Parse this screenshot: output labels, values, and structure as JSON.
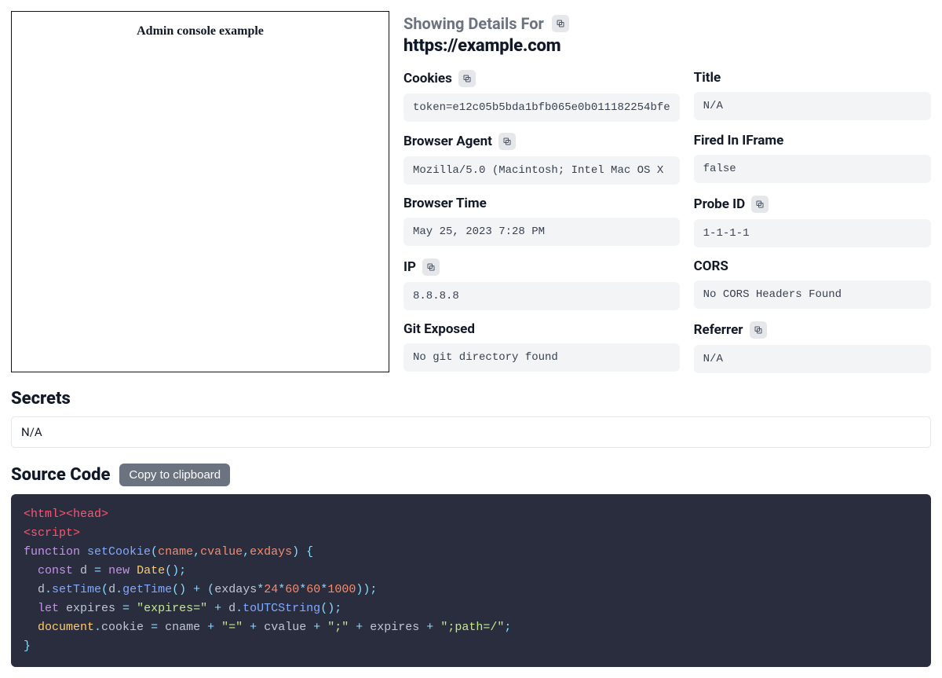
{
  "preview": {
    "title": "Admin console example"
  },
  "header": {
    "showing_label": "Showing Details For",
    "url": "https://example.com"
  },
  "fields": {
    "cookies": {
      "label": "Cookies",
      "value": "token=e12c05b5bda1bfb065e0b011182254bfe"
    },
    "title": {
      "label": "Title",
      "value": "N/A"
    },
    "browser_agent": {
      "label": "Browser Agent",
      "value": "Mozilla/5.0 (Macintosh; Intel Mac OS X"
    },
    "fired_iframe": {
      "label": "Fired In IFrame",
      "value": "false"
    },
    "browser_time": {
      "label": "Browser Time",
      "value": "May 25, 2023 7:28 PM"
    },
    "probe_id": {
      "label": "Probe ID",
      "value": "1-1-1-1"
    },
    "ip": {
      "label": "IP",
      "value": "8.8.8.8"
    },
    "cors": {
      "label": "CORS",
      "value": "No CORS Headers Found"
    },
    "git_exposed": {
      "label": "Git Exposed",
      "value": "No git directory found"
    },
    "referrer": {
      "label": "Referrer",
      "value": "N/A"
    }
  },
  "secrets": {
    "heading": "Secrets",
    "value": "N/A"
  },
  "source": {
    "heading": "Source Code",
    "copy_label": "Copy to clipboard"
  },
  "code_tokens": [
    [
      "tag",
      "<html>"
    ],
    [
      "tag",
      "<head>"
    ],
    [
      "nl",
      ""
    ],
    [
      "tag",
      "<script>"
    ],
    [
      "nl",
      ""
    ],
    [
      "kw",
      "function"
    ],
    [
      "default",
      " "
    ],
    [
      "fn",
      "setCookie"
    ],
    [
      "punct",
      "("
    ],
    [
      "param",
      "cname"
    ],
    [
      "punct",
      ","
    ],
    [
      "param",
      "cvalue"
    ],
    [
      "punct",
      ","
    ],
    [
      "param",
      "exdays"
    ],
    [
      "punct",
      ")"
    ],
    [
      "default",
      " "
    ],
    [
      "punct",
      "{"
    ],
    [
      "nl",
      ""
    ],
    [
      "default",
      "  "
    ],
    [
      "kw",
      "const"
    ],
    [
      "default",
      " d "
    ],
    [
      "punct",
      "="
    ],
    [
      "default",
      " "
    ],
    [
      "kw",
      "new"
    ],
    [
      "default",
      " "
    ],
    [
      "builtin",
      "Date"
    ],
    [
      "punct",
      "()"
    ],
    [
      "punct",
      ";"
    ],
    [
      "nl",
      ""
    ],
    [
      "default",
      "  d"
    ],
    [
      "punct",
      "."
    ],
    [
      "fn",
      "setTime"
    ],
    [
      "punct",
      "("
    ],
    [
      "default",
      "d"
    ],
    [
      "punct",
      "."
    ],
    [
      "fn",
      "getTime"
    ],
    [
      "punct",
      "()"
    ],
    [
      "default",
      " "
    ],
    [
      "punct",
      "+"
    ],
    [
      "default",
      " "
    ],
    [
      "punct",
      "("
    ],
    [
      "default",
      "exdays"
    ],
    [
      "punct",
      "*"
    ],
    [
      "num",
      "24"
    ],
    [
      "punct",
      "*"
    ],
    [
      "num",
      "60"
    ],
    [
      "punct",
      "*"
    ],
    [
      "num",
      "60"
    ],
    [
      "punct",
      "*"
    ],
    [
      "num",
      "1000"
    ],
    [
      "punct",
      "))"
    ],
    [
      "punct",
      ";"
    ],
    [
      "nl",
      ""
    ],
    [
      "default",
      "  "
    ],
    [
      "kw",
      "let"
    ],
    [
      "default",
      " expires "
    ],
    [
      "punct",
      "="
    ],
    [
      "default",
      " "
    ],
    [
      "str",
      "\"expires=\""
    ],
    [
      "default",
      " "
    ],
    [
      "punct",
      "+"
    ],
    [
      "default",
      " d"
    ],
    [
      "punct",
      "."
    ],
    [
      "fn",
      "toUTCString"
    ],
    [
      "punct",
      "()"
    ],
    [
      "punct",
      ";"
    ],
    [
      "nl",
      ""
    ],
    [
      "default",
      "  "
    ],
    [
      "builtin",
      "document"
    ],
    [
      "punct",
      "."
    ],
    [
      "prop",
      "cookie"
    ],
    [
      "default",
      " "
    ],
    [
      "punct",
      "="
    ],
    [
      "default",
      " cname "
    ],
    [
      "punct",
      "+"
    ],
    [
      "default",
      " "
    ],
    [
      "str",
      "\"=\""
    ],
    [
      "default",
      " "
    ],
    [
      "punct",
      "+"
    ],
    [
      "default",
      " cvalue "
    ],
    [
      "punct",
      "+"
    ],
    [
      "default",
      " "
    ],
    [
      "str",
      "\";\""
    ],
    [
      "default",
      " "
    ],
    [
      "punct",
      "+"
    ],
    [
      "default",
      " expires "
    ],
    [
      "punct",
      "+"
    ],
    [
      "default",
      " "
    ],
    [
      "str",
      "\";path=/\""
    ],
    [
      "punct",
      ";"
    ],
    [
      "nl",
      ""
    ],
    [
      "punct",
      "}"
    ]
  ]
}
